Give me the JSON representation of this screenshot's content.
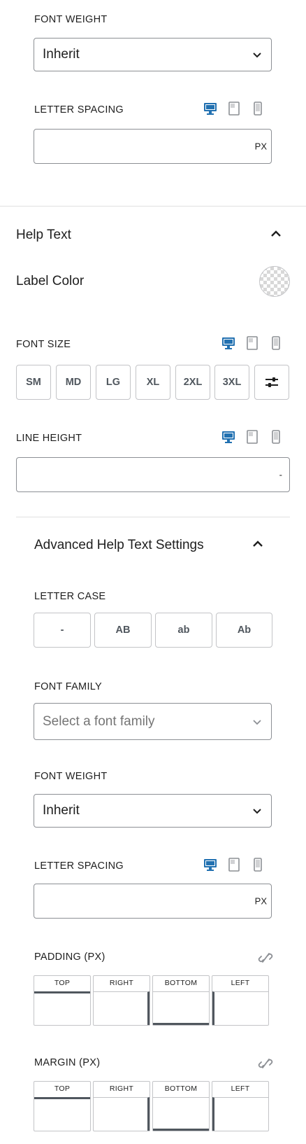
{
  "top": {
    "font_weight_label": "FONT WEIGHT",
    "font_weight_value": "Inherit",
    "letter_spacing_label": "LETTER SPACING",
    "letter_spacing_unit": "PX"
  },
  "help_text": {
    "title": "Help Text",
    "label_color": "Label Color",
    "font_size_label": "FONT SIZE",
    "sizes": [
      "SM",
      "MD",
      "LG",
      "XL",
      "2XL",
      "3XL"
    ],
    "line_height_label": "LINE HEIGHT",
    "line_height_unit": "-"
  },
  "advanced": {
    "title": "Advanced Help Text Settings",
    "letter_case_label": "LETTER CASE",
    "cases": [
      "-",
      "AB",
      "ab",
      "Ab"
    ],
    "font_family_label": "FONT FAMILY",
    "font_family_placeholder": "Select a font family",
    "font_weight_label": "FONT WEIGHT",
    "font_weight_value": "Inherit",
    "letter_spacing_label": "LETTER SPACING",
    "letter_spacing_unit": "PX",
    "padding_label": "PADDING (PX)",
    "margin_label": "MARGIN (PX)",
    "sides": [
      "TOP",
      "RIGHT",
      "BOTTOM",
      "LEFT"
    ]
  },
  "colors": {
    "accent": "#2271b1",
    "border": "#8c8f94",
    "muted_icon": "#8c8f94"
  }
}
